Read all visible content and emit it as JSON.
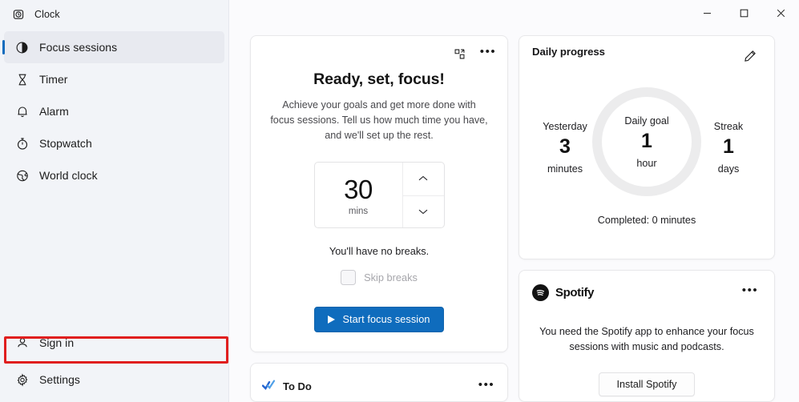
{
  "app": {
    "title": "Clock",
    "title_icon": "alarm-clock-icon"
  },
  "window_controls": {
    "minimize": "minimize-icon",
    "maximize": "maximize-icon",
    "close": "close-icon"
  },
  "sidebar": {
    "items": [
      {
        "label": "Focus sessions",
        "icon": "focus-sessions-icon",
        "selected": true
      },
      {
        "label": "Timer",
        "icon": "hourglass-icon",
        "selected": false
      },
      {
        "label": "Alarm",
        "icon": "bell-icon",
        "selected": false
      },
      {
        "label": "Stopwatch",
        "icon": "stopwatch-icon",
        "selected": false
      },
      {
        "label": "World clock",
        "icon": "globe-icon",
        "selected": false
      }
    ],
    "bottom_items": [
      {
        "label": "Sign in",
        "icon": "person-icon",
        "highlighted": true
      },
      {
        "label": "Settings",
        "icon": "gear-icon",
        "highlighted": false
      }
    ]
  },
  "focus_card": {
    "heading": "Ready, set, focus!",
    "description": "Achieve your goals and get more done with focus sessions. Tell us how much time you have, and we'll set up the rest.",
    "spinner": {
      "value": "30",
      "unit": "mins",
      "increase_icon": "chevron-up-icon",
      "decrease_icon": "chevron-down-icon"
    },
    "breaks_text": "You'll have no breaks.",
    "skip_breaks_label": "Skip breaks",
    "skip_breaks_checked": false,
    "start_button": "Start focus session",
    "actions": {
      "mini_view_icon": "pop-out-icon",
      "more_icon": "more-options-icon",
      "more_glyph": "•••"
    },
    "accent_color": "#0f6cbd"
  },
  "todo_card": {
    "label": "To Do",
    "icon": "microsoft-todo-icon",
    "more_glyph": "•••"
  },
  "progress_card": {
    "title": "Daily progress",
    "edit_icon": "pencil-edit-icon",
    "yesterday": {
      "label": "Yesterday",
      "value": "3",
      "unit": "minutes"
    },
    "goal": {
      "label": "Daily goal",
      "value": "1",
      "unit": "hour"
    },
    "streak": {
      "label": "Streak",
      "value": "1",
      "unit": "days"
    },
    "completed": "Completed: 0 minutes",
    "ring_track_color": "#ececed",
    "ring_progress_percent": 0
  },
  "spotify_card": {
    "name": "Spotify",
    "logo_icon": "spotify-logo-icon",
    "more_glyph": "•••",
    "description": "You need the Spotify app to enhance your focus sessions with music and podcasts.",
    "install_button": "Install Spotify"
  },
  "annotation": {
    "highlight_color": "#e01e1e",
    "target": "Sign in"
  }
}
